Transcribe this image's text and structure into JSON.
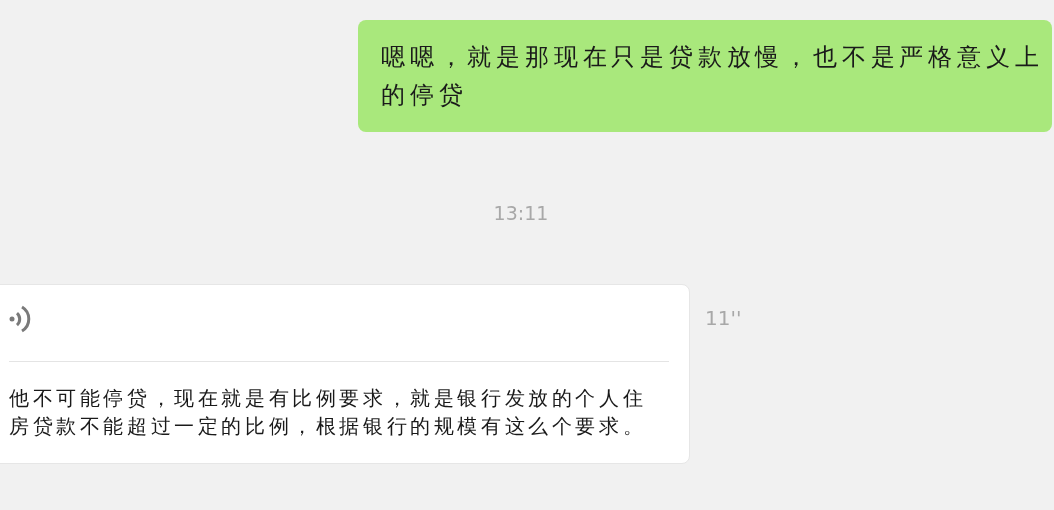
{
  "messages": [
    {
      "kind": "text",
      "outgoing": true,
      "text": "嗯嗯，就是那现在只是贷款放慢，也不是严格意义上的停贷"
    },
    {
      "kind": "time",
      "text": "13:11"
    },
    {
      "kind": "voice",
      "outgoing": false,
      "duration": "11''",
      "transcript": "他不可能停贷，现在就是有比例要求，就是银行发放的个人住房贷款不能超过一定的比例，根据银行的规模有这么个要求。"
    }
  ]
}
